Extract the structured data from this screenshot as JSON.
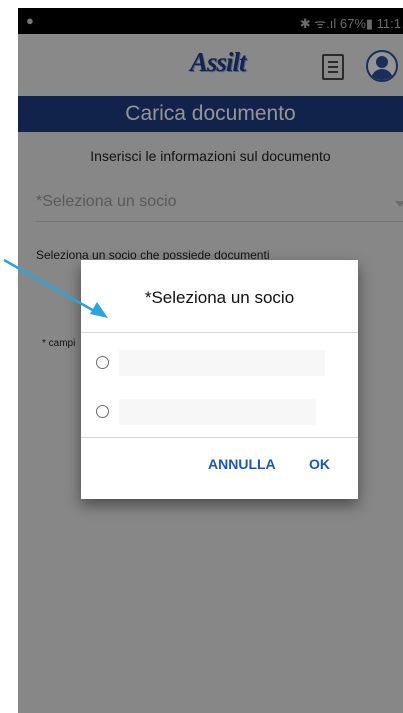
{
  "status_bar": {
    "text": "✱ ᯤ.ıl 67%▮ 11:1",
    "left_icon": "notification-icon"
  },
  "app_bar": {
    "logo_text": "Assilt",
    "icons": [
      "document-list-icon",
      "user-profile-icon"
    ]
  },
  "page": {
    "title": "Carica documento",
    "subtitle": "Inserisci le informazioni sul documento",
    "select_placeholder": "*Seleziona un socio",
    "hint": "Seleziona un socio che possiede documenti",
    "required_note": "* campi"
  },
  "dialog": {
    "title": "*Seleziona un socio",
    "options": [
      "",
      ""
    ],
    "cancel_label": "ANNULLA",
    "ok_label": "OK"
  },
  "colors": {
    "brand_blue": "#1f3d82",
    "button_blue": "#1c56b8",
    "annotation_arrow": "#2ba3dd"
  }
}
